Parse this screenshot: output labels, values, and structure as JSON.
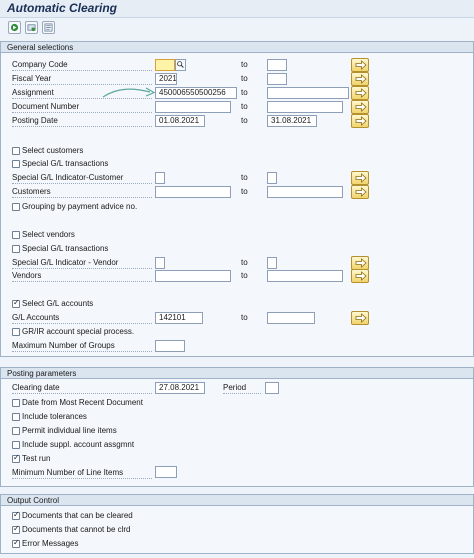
{
  "window": {
    "title": "Automatic Clearing"
  },
  "toolbar": {
    "icons": [
      "execute-icon",
      "variant-icon",
      "dynamic-selection-icon"
    ]
  },
  "general_selections": {
    "header": "General selections",
    "to_label": "to",
    "company_code": {
      "label": "Company Code",
      "from": "",
      "to": ""
    },
    "fiscal_year": {
      "label": "Fiscal Year",
      "from": "2021",
      "to": ""
    },
    "assignment": {
      "label": "Assignment",
      "from": "450006550500256",
      "to": ""
    },
    "document_number": {
      "label": "Document Number",
      "from": "",
      "to": ""
    },
    "posting_date": {
      "label": "Posting Date",
      "from": "01.08.2021",
      "to": "31.08.2021"
    },
    "select_customers": {
      "label": "Select customers",
      "checked": false
    },
    "special_gl_transactions_cust": {
      "label": "Special G/L transactions",
      "checked": false
    },
    "special_gl_indicator_customer": {
      "label": "Special G/L Indicator-Customer",
      "from": "",
      "to": ""
    },
    "customers": {
      "label": "Customers",
      "from": "",
      "to": ""
    },
    "grouping_payment_advice": {
      "label": "Grouping by payment advice no.",
      "checked": false
    },
    "select_vendors": {
      "label": "Select vendors",
      "checked": false
    },
    "special_gl_transactions_vend": {
      "label": "Special G/L transactions",
      "checked": false
    },
    "special_gl_indicator_vendor": {
      "label": "Special G/L Indicator - Vendor",
      "from": "",
      "to": ""
    },
    "vendors": {
      "label": "Vendors",
      "from": "",
      "to": ""
    },
    "select_gl_accounts": {
      "label": "Select G/L accounts",
      "checked": true
    },
    "gl_accounts": {
      "label": "G/L Accounts",
      "from": "142101",
      "to": ""
    },
    "gr_ir_special": {
      "label": "GR/IR account special process.",
      "checked": false
    },
    "max_groups": {
      "label": "Maximum Number of Groups",
      "value": ""
    }
  },
  "posting_parameters": {
    "header": "Posting parameters",
    "clearing_date": {
      "label": "Clearing date",
      "value": "27.08.2021"
    },
    "period": {
      "label": "Period",
      "value": ""
    },
    "date_from_recent": {
      "label": "Date from Most Recent Document",
      "checked": false
    },
    "include_tolerances": {
      "label": "Include tolerances",
      "checked": false
    },
    "permit_individual": {
      "label": "Permit individual line items",
      "checked": false
    },
    "include_suppl": {
      "label": "Include suppl. account assgmnt",
      "checked": false
    },
    "test_run": {
      "label": "Test run",
      "checked": true
    },
    "min_line_items": {
      "label": "Minimum Number of Line Items",
      "value": ""
    }
  },
  "output_control": {
    "header": "Output Control",
    "docs_cleared": {
      "label": "Documents that can be cleared",
      "checked": true
    },
    "docs_not_cleared": {
      "label": "Documents that cannot be clrd",
      "checked": true
    },
    "error_messages": {
      "label": "Error Messages",
      "checked": true
    }
  },
  "colors": {
    "background": "#eef3f9",
    "panel_header": "#dbe5f0",
    "multi_select_button": "#f1d36b",
    "annotation_arrow": "#5aa89c",
    "title_text": "#1a2f55"
  }
}
